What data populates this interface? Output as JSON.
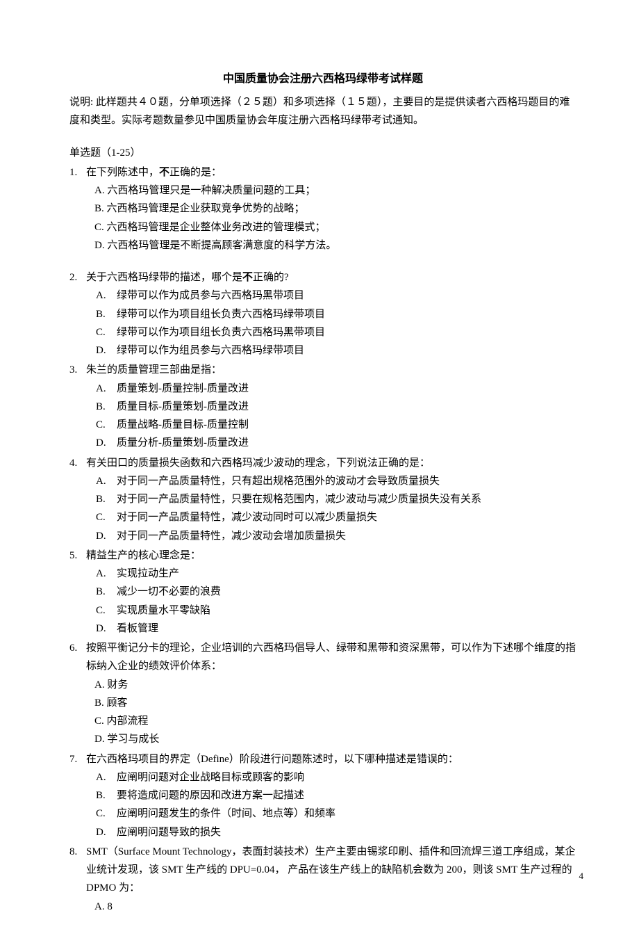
{
  "title": "中国质量协会注册六西格玛绿带考试样题",
  "intro": "说明: 此样题共４０题，分单项选择（２５题）和多项选择（１５题），主要目的是提供读者六西格玛题目的难度和类型。实际考题数量参见中国质量协会年度注册六西格玛绿带考试通知。",
  "section": "单选题（1-25）",
  "q1": {
    "num": "1.",
    "stem_pre": "在下列陈述中，",
    "stem_bold": "不",
    "stem_post": "正确的是：",
    "a": "A. 六西格玛管理只是一种解决质量问题的工具；",
    "b": "B. 六西格玛管理是企业获取竞争优势的战略；",
    "c": "C. 六西格玛管理是企业整体业务改进的管理模式；",
    "d": "D. 六西格玛管理是不断提高顾客满意度的科学方法。"
  },
  "q2": {
    "num": "2.",
    "stem_pre": "关于六西格玛绿带的描述，哪个是",
    "stem_bold": "不",
    "stem_post": "正确的?",
    "a_l": "A.",
    "a_t": "绿带可以作为成员参与六西格玛黑带项目",
    "b_l": "B.",
    "b_t": "绿带可以作为项目组长负责六西格玛绿带项目",
    "c_l": "C.",
    "c_t": "绿带可以作为项目组长负责六西格玛黑带项目",
    "d_l": "D.",
    "d_t": "绿带可以作为组员参与六西格玛绿带项目"
  },
  "q3": {
    "num": "3.",
    "stem": "朱兰的质量管理三部曲是指：",
    "a_l": "A.",
    "a_t": "质量策划-质量控制-质量改进",
    "b_l": "B.",
    "b_t": "质量目标-质量策划-质量改进",
    "c_l": "C.",
    "c_t": "质量战略-质量目标-质量控制",
    "d_l": "D.",
    "d_t": "质量分析-质量策划-质量改进"
  },
  "q4": {
    "num": "4.",
    "stem": "有关田口的质量损失函数和六西格玛减少波动的理念，下列说法正确的是：",
    "a_l": "A.",
    "a_t": "对于同一产品质量特性，只有超出规格范围外的波动才会导致质量损失",
    "b_l": "B.",
    "b_t": "对于同一产品质量特性，只要在规格范围内，减少波动与减少质量损失没有关系",
    "c_l": "C.",
    "c_t": "对于同一产品质量特性，减少波动同时可以减少质量损失",
    "d_l": "D.",
    "d_t": "对于同一产品质量特性，减少波动会增加质量损失"
  },
  "q5": {
    "num": "5.",
    "stem": " 精益生产的核心理念是：",
    "a_l": "A.",
    "a_t": "实现拉动生产",
    "b_l": "B.",
    "b_t": "减少一切不必要的浪费",
    "c_l": "C.",
    "c_t": "实现质量水平零缺陷",
    "d_l": "D.",
    "d_t": "看板管理"
  },
  "q6": {
    "num": "6.",
    "stem": "按照平衡记分卡的理论，企业培训的六西格玛倡导人、绿带和黑带和资深黑带，可以作为下述哪个维度的指标纳入企业的绩效评价体系：",
    "a": "A.  财务",
    "b": "B.  顾客",
    "c": "C.  内部流程",
    "d": "D.  学习与成长"
  },
  "q7": {
    "num": "7.",
    "stem": "在六西格玛项目的界定（Define）阶段进行问题陈述时，以下哪种描述是错误的：",
    "a_l": "A.",
    "a_t": " 应阐明问题对企业战略目标或顾客的影响",
    "b_l": "B.",
    "b_t": " 要将造成问题的原因和改进方案一起描述",
    "c_l": "C.",
    "c_t": " 应阐明问题发生的条件（时间、地点等）和频率",
    "d_l": "D.",
    "d_t": " 应阐明问题导致的损失"
  },
  "q8": {
    "num": "8.",
    "stem": "SMT（Surface Mount Technology，表面封装技术）生产主要由锡浆印刷、插件和回流焊三道工序组成，某企业统计发现，该 SMT 生产线的 DPU=0.04，  产品在该生产线上的缺陷机会数为 200，则该 SMT 生产过程的 DPMO 为：",
    "a": "A.    8"
  },
  "page_num": "4"
}
